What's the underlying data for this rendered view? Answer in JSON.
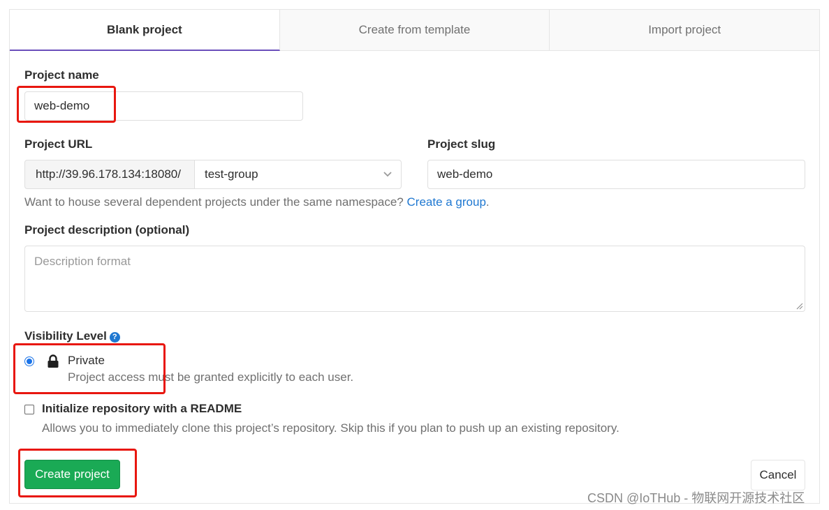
{
  "tabs": [
    {
      "label": "Blank project",
      "active": true
    },
    {
      "label": "Create from template",
      "active": false
    },
    {
      "label": "Import project",
      "active": false
    }
  ],
  "project_name": {
    "label": "Project name",
    "value": "web-demo"
  },
  "project_url": {
    "label": "Project URL",
    "prefix": "http://39.96.178.134:18080/",
    "namespace": "test-group"
  },
  "project_slug": {
    "label": "Project slug",
    "value": "web-demo"
  },
  "namespace_help": {
    "text": "Want to house several dependent projects under the same namespace?",
    "link": "Create a group",
    "suffix": "."
  },
  "description": {
    "label": "Project description (optional)",
    "placeholder": "Description format"
  },
  "visibility": {
    "label": "Visibility Level",
    "help_icon": "question-circle-icon",
    "option_title": "Private",
    "option_desc": "Project access must be granted explicitly to each user.",
    "selected": true
  },
  "readme": {
    "label": "Initialize repository with a README",
    "desc": "Allows you to immediately clone this project’s repository. Skip this if you plan to push up an existing repository.",
    "checked": false
  },
  "buttons": {
    "create": "Create project",
    "cancel": "Cancel"
  },
  "watermark": "CSDN @IoTHub - 物联网开源技术社区",
  "colors": {
    "primary_green": "#1aaa55",
    "link_blue": "#1f78d1",
    "active_tab_underline": "#6b4fbb",
    "highlight_red": "#e8170f"
  }
}
